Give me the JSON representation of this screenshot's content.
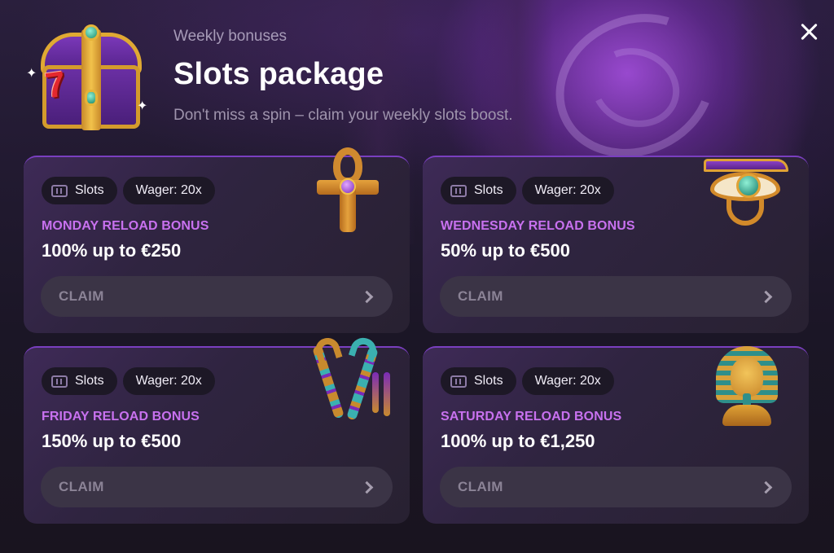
{
  "header": {
    "subtitle": "Weekly bonuses",
    "title": "Slots package",
    "description": "Don't miss a spin – claim your weekly slots boost."
  },
  "chest": {
    "seven_text": "7"
  },
  "cards": [
    {
      "tag_category": "Slots",
      "tag_wager": "Wager: 20x",
      "name": "MONDAY RELOAD BONUS",
      "amount": "100% up to €250",
      "claim_label": "CLAIM",
      "artifact_icon": "ankh-icon"
    },
    {
      "tag_category": "Slots",
      "tag_wager": "Wager: 20x",
      "name": "WEDNESDAY RELOAD BONUS",
      "amount": "50% up to €500",
      "claim_label": "CLAIM",
      "artifact_icon": "eye-of-horus-icon"
    },
    {
      "tag_category": "Slots",
      "tag_wager": "Wager: 20x",
      "name": "FRIDAY RELOAD BONUS",
      "amount": "150% up to €500",
      "claim_label": "CLAIM",
      "artifact_icon": "crook-and-flail-icon"
    },
    {
      "tag_category": "Slots",
      "tag_wager": "Wager: 20x",
      "name": "SATURDAY RELOAD BONUS",
      "amount": "100% up to €1,250",
      "claim_label": "CLAIM",
      "artifact_icon": "pharaoh-bust-icon"
    }
  ],
  "colors": {
    "accent_purple": "#c871ef",
    "card_border": "#7a3fc0",
    "claim_bg": "#3b3446",
    "tag_bg": "#1d1826"
  }
}
